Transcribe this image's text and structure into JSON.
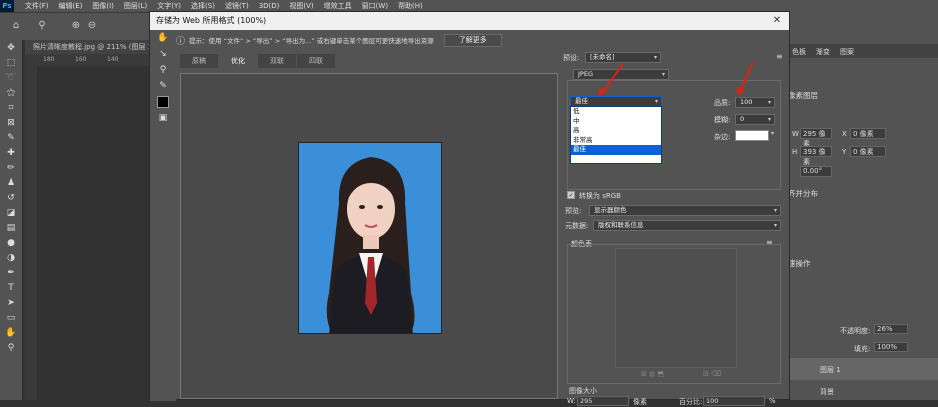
{
  "menubar": {
    "logo": "Ps",
    "items": [
      "文件(F)",
      "编辑(E)",
      "图像(I)",
      "图层(L)",
      "文字(Y)",
      "选择(S)",
      "滤镜(T)",
      "3D(D)",
      "视图(V)",
      "增效工具",
      "窗口(W)",
      "帮助(H)"
    ]
  },
  "document_tab": "照片清晰度教程.jpg @ 211% (图层 1,",
  "ruler_marks": [
    "180",
    "160",
    "140"
  ],
  "dialog": {
    "title": "存储为 Web 所用格式 (100%)",
    "hint": "提示：使用 “文件” > “导出” > “导出为...” 或右键单击某个图层可更快速地导出资源",
    "learn_more": "了解更多",
    "tabs": [
      "原稿",
      "优化",
      "双联",
      "四联"
    ],
    "active_tab": "优化",
    "preset_label": "预设:",
    "preset_value": "[未命名]",
    "format_value": "JPEG",
    "quality_select_value": "最佳",
    "quality_options": [
      "低",
      "中",
      "高",
      "非常高",
      "最佳"
    ],
    "selected_quality_option": "最佳",
    "quality_label": "品质:",
    "quality_value": "100",
    "blur_label": "模糊:",
    "blur_value": "0",
    "matte_label": "杂边:",
    "convert_label": "转换为 sRGB",
    "preview_label": "预览:",
    "preview_value": "显示器颜色",
    "metadata_label": "元数据:",
    "metadata_value": "版权和联系信息",
    "color_table_label": "颜色表",
    "image_size_label": "图像大小",
    "width_label": "W:",
    "width_value": "295",
    "width_unit": "像素",
    "percent_label": "百分比:",
    "percent_value": "100",
    "percent_unit": "%"
  },
  "panels": {
    "tabs": [
      "色板",
      "渐变",
      "图案"
    ],
    "properties_title": "像素图层",
    "w_label": "W",
    "w_value": "295 像素",
    "h_label": "H",
    "h_value": "393 像素",
    "x_label": "X",
    "x_value": "0 像素",
    "y_label": "Y",
    "y_value": "0 像素",
    "angle_value": "0.00°",
    "align_title": "齐并分布",
    "quick_title": "速操作",
    "opacity_label": "不透明度:",
    "opacity_value": "26%",
    "fill_label": "填充:",
    "fill_value": "100%",
    "layers": [
      "图层 1",
      "背景"
    ]
  },
  "colors": {
    "app_bg": "#535353",
    "photo_bg": "#3b8fd9",
    "selection": "#0f5fd7",
    "annotation_arrow": "#e02010"
  }
}
